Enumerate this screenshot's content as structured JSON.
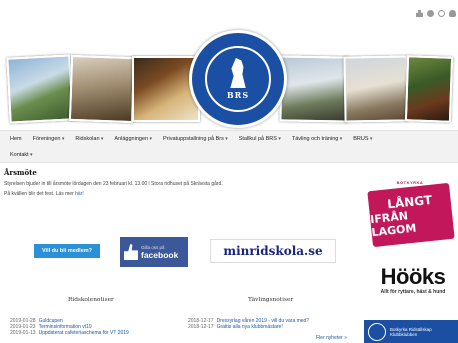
{
  "top_icons": [
    "sitemap-icon",
    "help-icon",
    "search-icon",
    "user-icon"
  ],
  "logo": {
    "ring_text": "BOTKYRKA RIDSÄLLSKAP",
    "abbr": "BRS"
  },
  "nav": {
    "row1": [
      {
        "label": "Hem",
        "dropdown": false
      },
      {
        "label": "Föreningen",
        "dropdown": true
      },
      {
        "label": "Ridskolan",
        "dropdown": true
      },
      {
        "label": "Anläggningen",
        "dropdown": true
      },
      {
        "label": "Privatuppstallning på Brs",
        "dropdown": true
      },
      {
        "label": "Stallkul på BRS",
        "dropdown": true
      },
      {
        "label": "Tävling och träning",
        "dropdown": true
      },
      {
        "label": "BRUS",
        "dropdown": true
      }
    ],
    "row2": [
      {
        "label": "Kontakt",
        "dropdown": true
      }
    ]
  },
  "main": {
    "title": "Årsmöte",
    "para1": "Styrelsen bjuder in till årsmöte lördagen den 23 februari kl. 13.00 i Stora ridhuset på Skrävsta gård.",
    "para2_prefix": "På kvällen blir det fest. Läs mer ",
    "para2_link": "här!"
  },
  "member_button": "Vill du bli medlem?",
  "facebook": {
    "small": "Gilla oss på",
    "big": "facebook"
  },
  "minridskola": "minridskola.se",
  "ridskolenotiser": {
    "title": "Ridskolenotiser",
    "items": [
      {
        "date": "2019-01-28",
        "text": "Guldcupen"
      },
      {
        "date": "2019-01-23",
        "text": "Terminsinformation vt19"
      },
      {
        "date": "2019-01-13",
        "text": "Uppdaterat cafeteriaschema för VT 2019"
      }
    ]
  },
  "tavlingsnotiser": {
    "title": "Tävlingsnotiser",
    "items": [
      {
        "date": "2018-12-17",
        "text": "Dressyrlag våren 2019 - vill du vara med?"
      },
      {
        "date": "2018-12-17",
        "text": "Grattis alla nya klubbmästare!"
      }
    ],
    "more": "Fler nyheter »"
  },
  "ads": {
    "botkyrka_badge": {
      "top": "BOTKYRKA",
      "line1": "LÅNGT",
      "line2": "IFRÅN LAGOM"
    },
    "hooks": {
      "name": "Hööks",
      "tagline": "Allt för ryttare, häst & hund"
    },
    "brs": {
      "line1": "Botkyrka Ridsällskap",
      "line2": "Klubbklubben"
    }
  },
  "colors": {
    "brand_blue": "#1a4fa3",
    "link_blue": "#1e5aa8",
    "facebook_blue": "#3b5998",
    "member_button": "#2a90d8",
    "botkyrka_pink": "#c2185b"
  }
}
